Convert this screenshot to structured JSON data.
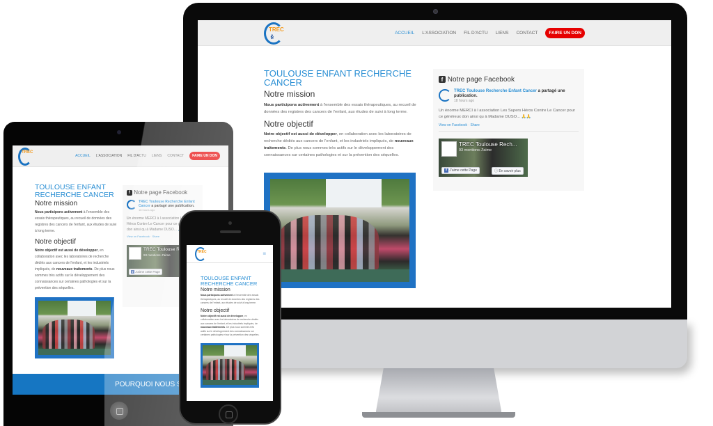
{
  "site": {
    "logo_text": "TREC",
    "nav": [
      {
        "label": "ACCUEIL",
        "active": true
      },
      {
        "label": "L'ASSOCIATION",
        "active": false
      },
      {
        "label": "FIL D'ACTU",
        "active": false
      },
      {
        "label": "LIENS",
        "active": false
      },
      {
        "label": "CONTACT",
        "active": false
      }
    ],
    "cta_button": "FAIRE UN DON",
    "menu_icon": "hamburger-menu-icon",
    "colors": {
      "accent": "#2b8fd4",
      "cta": "#e60000",
      "band": "#1676c2",
      "photo_frame": "#1f72c4"
    }
  },
  "content": {
    "title": "TOULOUSE ENFANT RECHERCHE CANCER",
    "mission_heading": "Notre mission",
    "mission_bold": "Nous participons activement",
    "mission_text": " à l'ensemble des essais thérapeutiques, au recueil de données des registres des cancers de l'enfant, aux études de suivi à long terme.",
    "objective_heading": "Notre objectif",
    "objective_bold1": "Notre objectif est aussi de développer",
    "objective_text1": ", en collaboration avec les laboratoires de recherche dédiés aux cancers de l'enfant, et les industriels impliqués, de ",
    "objective_bold2": "nouveaux traitements",
    "objective_text2": ". De plus nous sommes très actifs sur le développement des connaissances sur certaines pathologies et sur la prévention des séquelles.",
    "photo_alt": "Group photo of team members in a park"
  },
  "facebook": {
    "heading": "Notre page Facebook",
    "page_name": "TREC Toulouse Recherche Enfant Cancer",
    "shared_text": " a partagé une publication.",
    "time": "18 hours ago",
    "post_text": "Un énorme MERCI à l association Les Supers Héros Contre Le Cancer pour ce généreux don ainsi qu à Madame DUSO... 🙏🙏",
    "view_link": "View on Facebook",
    "separator": "·",
    "share_link": "Share",
    "cover_name": "TREC Toulouse Rech...",
    "likes": "93 mentions J'aime",
    "like_button": "J'aime cette Page",
    "more_button": "En savoir plus"
  },
  "tablet": {
    "band_text": "POURQUOI NOUS SOUTENIR ?"
  }
}
